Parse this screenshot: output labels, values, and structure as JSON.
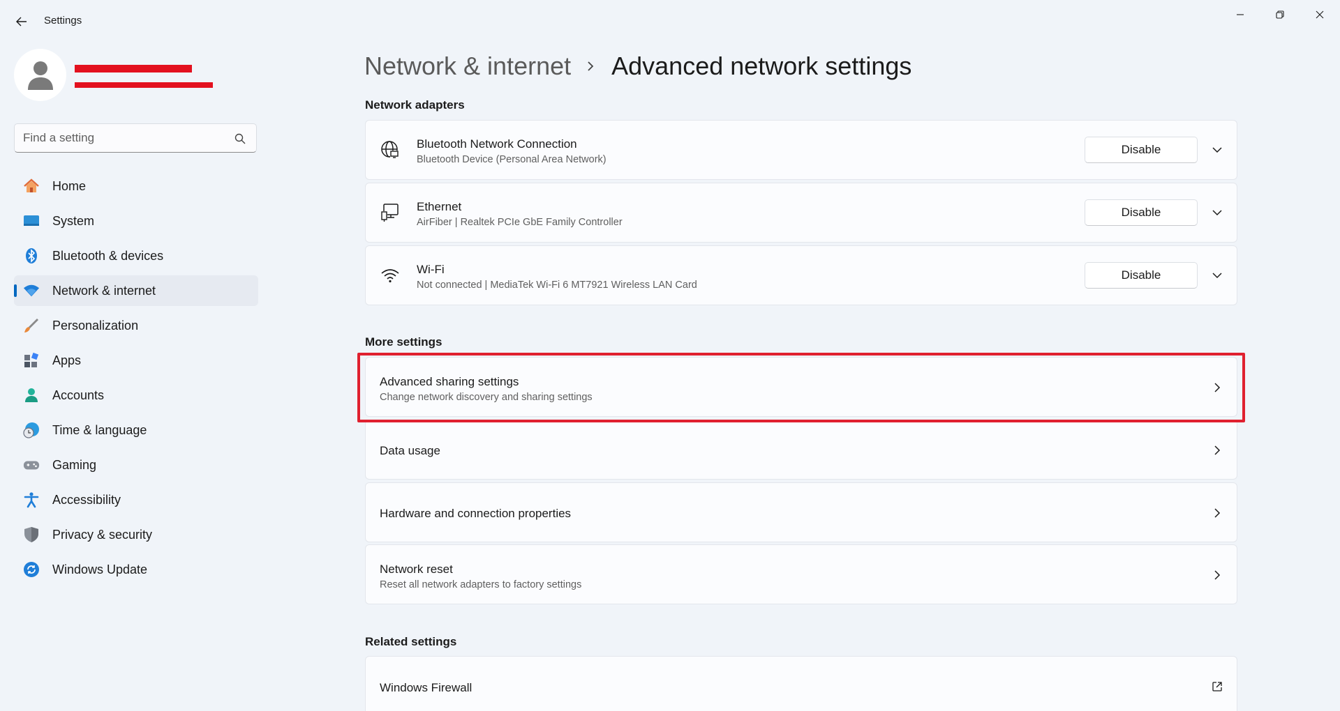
{
  "app": {
    "title": "Settings"
  },
  "window_controls": {
    "minimize_icon": "minimize-icon",
    "restore_icon": "restore-icon",
    "close_icon": "close-icon"
  },
  "profile": {
    "name_redacted": true,
    "email_redacted": true
  },
  "search": {
    "placeholder": "Find a setting"
  },
  "sidebar": {
    "items": [
      {
        "label": "Home",
        "icon": "home-icon",
        "active": false
      },
      {
        "label": "System",
        "icon": "system-icon",
        "active": false
      },
      {
        "label": "Bluetooth & devices",
        "icon": "bluetooth-icon",
        "active": false
      },
      {
        "label": "Network & internet",
        "icon": "wifi-icon",
        "active": true
      },
      {
        "label": "Personalization",
        "icon": "brush-icon",
        "active": false
      },
      {
        "label": "Apps",
        "icon": "apps-icon",
        "active": false
      },
      {
        "label": "Accounts",
        "icon": "accounts-icon",
        "active": false
      },
      {
        "label": "Time & language",
        "icon": "globe-clock-icon",
        "active": false
      },
      {
        "label": "Gaming",
        "icon": "gamepad-icon",
        "active": false
      },
      {
        "label": "Accessibility",
        "icon": "accessibility-icon",
        "active": false
      },
      {
        "label": "Privacy & security",
        "icon": "shield-icon",
        "active": false
      },
      {
        "label": "Windows Update",
        "icon": "update-icon",
        "active": false
      }
    ]
  },
  "breadcrumb": {
    "parent": "Network & internet",
    "current": "Advanced network settings"
  },
  "network_adapters": {
    "title": "Network adapters",
    "adapters": [
      {
        "name": "Bluetooth Network Connection",
        "description": "Bluetooth Device (Personal Area Network)",
        "button": "Disable",
        "icon": "globe-network-icon"
      },
      {
        "name": "Ethernet",
        "description": "AirFiber | Realtek PCIe GbE Family Controller",
        "button": "Disable",
        "icon": "ethernet-icon"
      },
      {
        "name": "Wi-Fi",
        "description": "Not connected | MediaTek Wi-Fi 6 MT7921 Wireless LAN Card",
        "button": "Disable",
        "icon": "wifi-icon"
      }
    ]
  },
  "more_settings": {
    "title": "More settings",
    "items": [
      {
        "title": "Advanced sharing settings",
        "subtitle": "Change network discovery and sharing settings",
        "highlighted": true
      },
      {
        "title": "Data usage",
        "subtitle": ""
      },
      {
        "title": "Hardware and connection properties",
        "subtitle": ""
      },
      {
        "title": "Network reset",
        "subtitle": "Reset all network adapters to factory settings"
      }
    ]
  },
  "related_settings": {
    "title": "Related settings",
    "items": [
      {
        "title": "Windows Firewall",
        "icon": "external-link-icon"
      }
    ]
  },
  "colors": {
    "accent": "#0067c0",
    "highlight_border": "#e0202f",
    "background": "#f0f4f9",
    "card": "#fbfcfe"
  }
}
